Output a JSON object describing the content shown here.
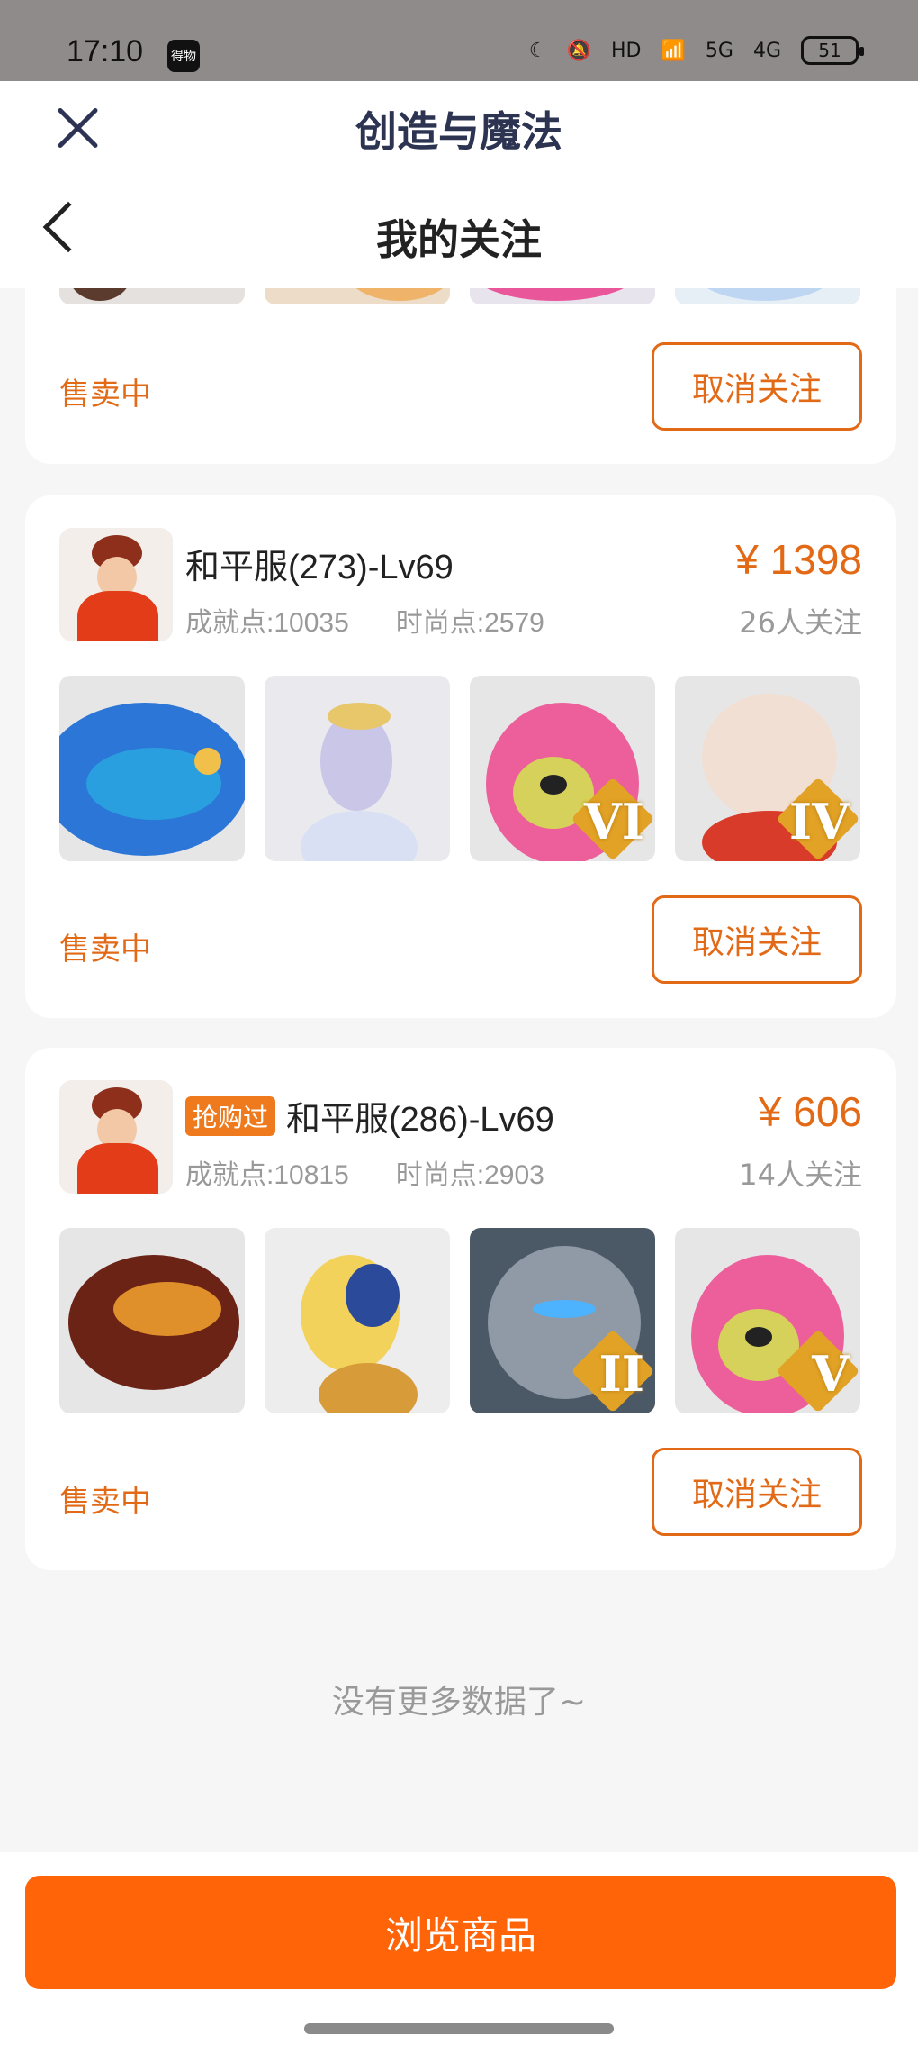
{
  "status_bar": {
    "time": "17:10",
    "app_badge": "得物",
    "battery": "51",
    "network1": "5G",
    "network2": "4G",
    "hd": "HD"
  },
  "header": {
    "app_title": "创造与魔法",
    "page_title": "我的关注"
  },
  "list": {
    "clipped_card": {
      "status": "售卖中",
      "unfollow": "取消关注"
    },
    "items": [
      {
        "tag": "",
        "name": "和平服(273)-Lv69",
        "achievement": "成就点:10035",
        "fashion": "时尚点:2579",
        "price": "¥ 1398",
        "followers": "26人关注",
        "status": "售卖中",
        "unfollow": "取消关注",
        "thumb_ranks": [
          "",
          "",
          "VI",
          "IV"
        ]
      },
      {
        "tag": "抢购过",
        "name": "和平服(286)-Lv69",
        "achievement": "成就点:10815",
        "fashion": "时尚点:2903",
        "price": "¥ 606",
        "followers": "14人关注",
        "status": "售卖中",
        "unfollow": "取消关注",
        "thumb_ranks": [
          "",
          "",
          "II",
          "V"
        ]
      }
    ],
    "end_text": "没有更多数据了~"
  },
  "footer": {
    "browse_button": "浏览商品"
  },
  "colors": {
    "accent": "#e26a17",
    "button": "#ff6409"
  }
}
